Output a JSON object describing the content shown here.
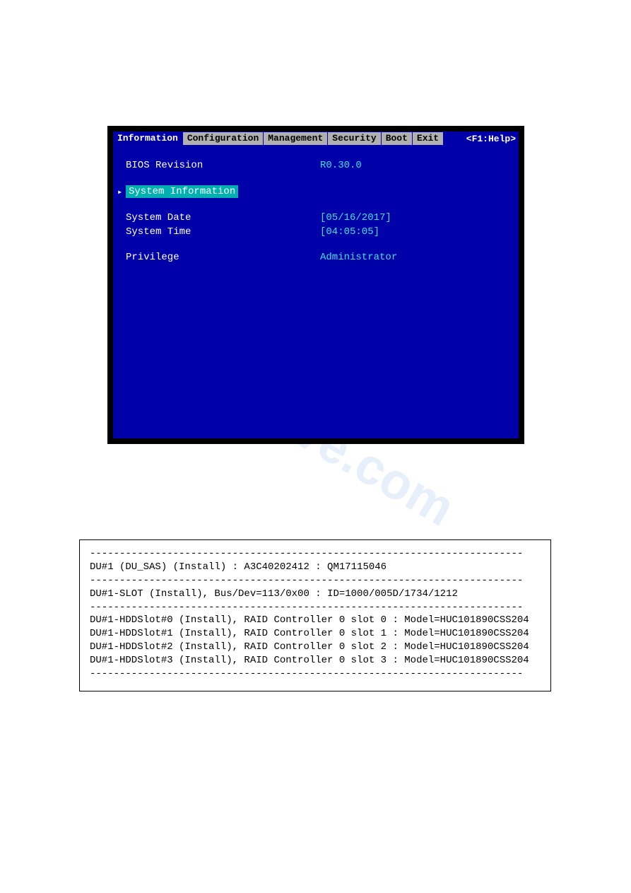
{
  "bios": {
    "tabs": {
      "information": "Information",
      "configuration": "Configuration",
      "management": "Management",
      "security": "Security",
      "boot": "Boot",
      "exit": "Exit"
    },
    "help_hint": "<F1:Help>",
    "fields": {
      "bios_revision_label": "BIOS Revision",
      "bios_revision_value": "R0.30.0",
      "system_information": "System Information",
      "system_date_label": "System Date",
      "system_date_value": "[05/16/2017]",
      "system_time_label": "System Time",
      "system_time_value": "[04:05:05]",
      "privilege_label": "Privilege",
      "privilege_value": "Administrator"
    }
  },
  "separator": "-------------------------------------------------------------------------",
  "terminal": {
    "line1": "DU#1 (DU_SAS) (Install) : A3C40202412     : QM17115046",
    "line2": "DU#1-SLOT (Install), Bus/Dev=113/0x00 : ID=1000/005D/1734/1212",
    "hdd": [
      "DU#1-HDDSlot#0 (Install), RAID Controller 0 slot 0 : Model=HUC101890CSS204",
      "DU#1-HDDSlot#1 (Install), RAID Controller 0 slot 1 : Model=HUC101890CSS204",
      "DU#1-HDDSlot#2 (Install), RAID Controller 0 slot 2 : Model=HUC101890CSS204",
      "DU#1-HDDSlot#3 (Install), RAID Controller 0 slot 3 : Model=HUC101890CSS204"
    ]
  },
  "watermark": "nualshive.com"
}
